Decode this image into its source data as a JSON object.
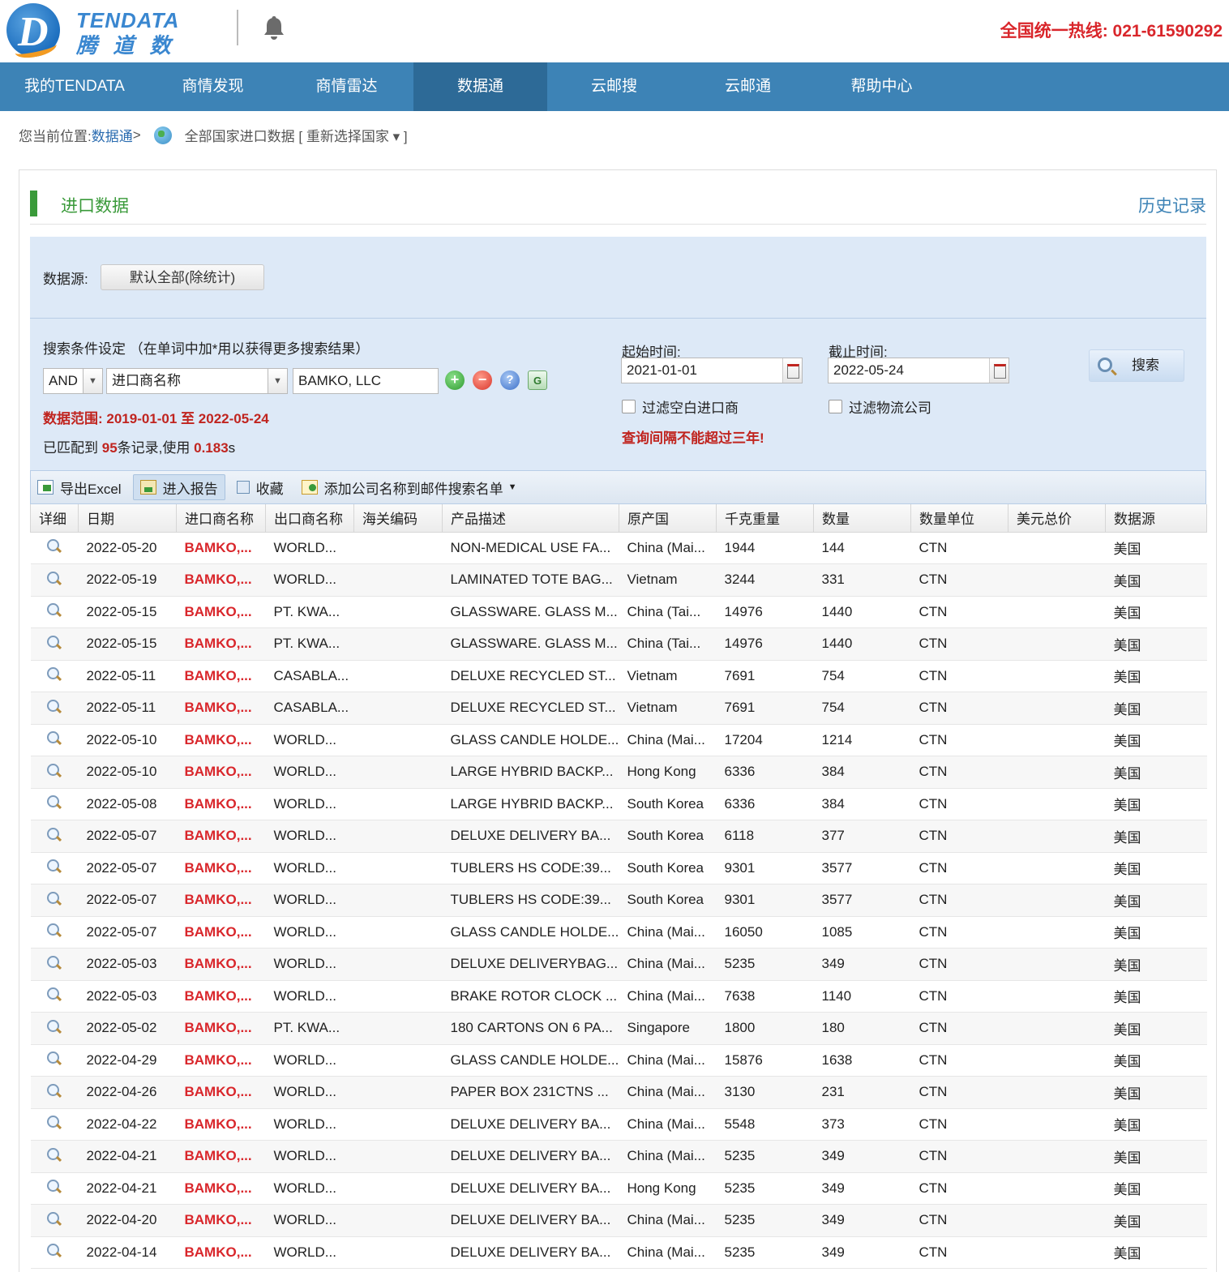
{
  "header": {
    "logo_en": "TENDATA",
    "logo_cn": "腾 道 数 据",
    "hotline": "全国统一热线:  021-61590292"
  },
  "nav": [
    "我的TENDATA",
    "商情发现",
    "商情雷达",
    "数据通",
    "云邮搜",
    "云邮通",
    "帮助中心"
  ],
  "nav_active_index": 3,
  "breadcrumb": {
    "prefix": "您当前位置: ",
    "link": "数据通",
    "sep": " >",
    "current": "全部国家进口数据 [ 重新选择国家 ▾ ]"
  },
  "section": {
    "title": "进口数据",
    "history": "历史记录"
  },
  "filter": {
    "source_label": "数据源:",
    "source_value": "默认全部(除统计)",
    "cond_title": "搜索条件设定 （在单词中加*用以获得更多搜索结果）",
    "logic": "AND",
    "field": "进口商名称",
    "keyword": "BAMKO, LLC",
    "range_text": "数据范围:  2019-01-01 至 2022-05-24",
    "matched_prefix": "已匹配到 ",
    "matched_count": "95",
    "matched_mid": "条记录,使用 ",
    "matched_time": "0.183",
    "matched_suffix": "s",
    "start_label": "起始时间:",
    "start_value": "2021-01-01",
    "end_label": "截止时间:",
    "end_value": "2022-05-24",
    "filter_blank": "过滤空白进口商",
    "filter_logistics": "过滤物流公司",
    "warning": "查询间隔不能超过三年!",
    "search": "搜索"
  },
  "toolbar": {
    "export": "导出Excel",
    "report": "进入报告",
    "favorite": "收藏",
    "add_mail": "添加公司名称到邮件搜索名单"
  },
  "table": {
    "headers": [
      "详细",
      "日期",
      "进口商名称",
      "出口商名称",
      "海关编码",
      "产品描述",
      "原产国",
      "千克重量",
      "数量",
      "数量单位",
      "美元总价",
      "数据源"
    ],
    "rows": [
      [
        "2022-05-20",
        "BAMKO,...",
        "WORLD...",
        "",
        "NON-MEDICAL USE FA...",
        "China (Mai...",
        "1944",
        "144",
        "CTN",
        "",
        "美国"
      ],
      [
        "2022-05-19",
        "BAMKO,...",
        "WORLD...",
        "",
        "LAMINATED TOTE BAG...",
        "Vietnam",
        "3244",
        "331",
        "CTN",
        "",
        "美国"
      ],
      [
        "2022-05-15",
        "BAMKO,...",
        "PT. KWA...",
        "",
        "GLASSWARE. GLASS M...",
        "China (Tai...",
        "14976",
        "1440",
        "CTN",
        "",
        "美国"
      ],
      [
        "2022-05-15",
        "BAMKO,...",
        "PT. KWA...",
        "",
        "GLASSWARE. GLASS M...",
        "China (Tai...",
        "14976",
        "1440",
        "CTN",
        "",
        "美国"
      ],
      [
        "2022-05-11",
        "BAMKO,...",
        "CASABLA...",
        "",
        "DELUXE RECYCLED ST...",
        "Vietnam",
        "7691",
        "754",
        "CTN",
        "",
        "美国"
      ],
      [
        "2022-05-11",
        "BAMKO,...",
        "CASABLA...",
        "",
        "DELUXE RECYCLED ST...",
        "Vietnam",
        "7691",
        "754",
        "CTN",
        "",
        "美国"
      ],
      [
        "2022-05-10",
        "BAMKO,...",
        "WORLD...",
        "",
        "GLASS CANDLE HOLDE...",
        "China (Mai...",
        "17204",
        "1214",
        "CTN",
        "",
        "美国"
      ],
      [
        "2022-05-10",
        "BAMKO,...",
        "WORLD...",
        "",
        "LARGE HYBRID BACKP...",
        "Hong Kong",
        "6336",
        "384",
        "CTN",
        "",
        "美国"
      ],
      [
        "2022-05-08",
        "BAMKO,...",
        "WORLD...",
        "",
        "LARGE HYBRID BACKP...",
        "South Korea",
        "6336",
        "384",
        "CTN",
        "",
        "美国"
      ],
      [
        "2022-05-07",
        "BAMKO,...",
        "WORLD...",
        "",
        "DELUXE DELIVERY BA...",
        "South Korea",
        "6118",
        "377",
        "CTN",
        "",
        "美国"
      ],
      [
        "2022-05-07",
        "BAMKO,...",
        "WORLD...",
        "",
        "TUBLERS HS CODE:39...",
        "South Korea",
        "9301",
        "3577",
        "CTN",
        "",
        "美国"
      ],
      [
        "2022-05-07",
        "BAMKO,...",
        "WORLD...",
        "",
        "TUBLERS HS CODE:39...",
        "South Korea",
        "9301",
        "3577",
        "CTN",
        "",
        "美国"
      ],
      [
        "2022-05-07",
        "BAMKO,...",
        "WORLD...",
        "",
        "GLASS CANDLE HOLDE...",
        "China (Mai...",
        "16050",
        "1085",
        "CTN",
        "",
        "美国"
      ],
      [
        "2022-05-03",
        "BAMKO,...",
        "WORLD...",
        "",
        "DELUXE DELIVERYBAG...",
        "China (Mai...",
        "5235",
        "349",
        "CTN",
        "",
        "美国"
      ],
      [
        "2022-05-03",
        "BAMKO,...",
        "WORLD...",
        "",
        "BRAKE ROTOR CLOCK ...",
        "China (Mai...",
        "7638",
        "1140",
        "CTN",
        "",
        "美国"
      ],
      [
        "2022-05-02",
        "BAMKO,...",
        "PT. KWA...",
        "",
        "180 CARTONS ON 6 PA...",
        "Singapore",
        "1800",
        "180",
        "CTN",
        "",
        "美国"
      ],
      [
        "2022-04-29",
        "BAMKO,...",
        "WORLD...",
        "",
        "GLASS CANDLE HOLDE...",
        "China (Mai...",
        "15876",
        "1638",
        "CTN",
        "",
        "美国"
      ],
      [
        "2022-04-26",
        "BAMKO,...",
        "WORLD...",
        "",
        "PAPER BOX 231CTNS ...",
        "China (Mai...",
        "3130",
        "231",
        "CTN",
        "",
        "美国"
      ],
      [
        "2022-04-22",
        "BAMKO,...",
        "WORLD...",
        "",
        "DELUXE DELIVERY BA...",
        "China (Mai...",
        "5548",
        "373",
        "CTN",
        "",
        "美国"
      ],
      [
        "2022-04-21",
        "BAMKO,...",
        "WORLD...",
        "",
        "DELUXE DELIVERY BA...",
        "China (Mai...",
        "5235",
        "349",
        "CTN",
        "",
        "美国"
      ],
      [
        "2022-04-21",
        "BAMKO,...",
        "WORLD...",
        "",
        "DELUXE DELIVERY BA...",
        "Hong Kong",
        "5235",
        "349",
        "CTN",
        "",
        "美国"
      ],
      [
        "2022-04-20",
        "BAMKO,...",
        "WORLD...",
        "",
        "DELUXE DELIVERY BA...",
        "China (Mai...",
        "5235",
        "349",
        "CTN",
        "",
        "美国"
      ],
      [
        "2022-04-14",
        "BAMKO,...",
        "WORLD...",
        "",
        "DELUXE DELIVERY BA...",
        "China (Mai...",
        "5235",
        "349",
        "CTN",
        "",
        "美国"
      ]
    ]
  }
}
